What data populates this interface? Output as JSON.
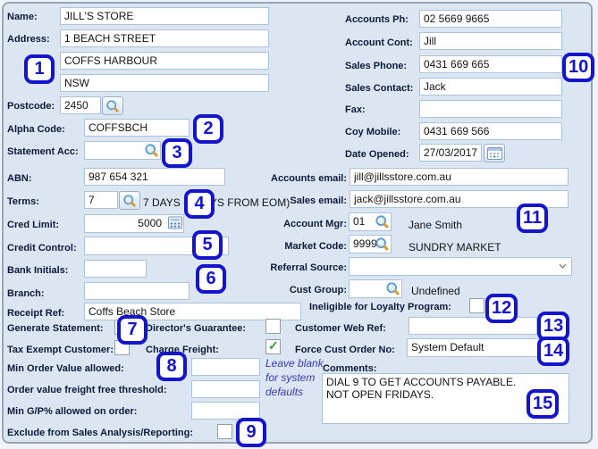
{
  "colors": {
    "accent": "#1414cd",
    "panel_bg": "#dce6f2",
    "check_green": "#2f9e33",
    "hint_blue": "#3939b8"
  },
  "badges": [
    "1",
    "2",
    "3",
    "4",
    "5",
    "6",
    "7",
    "8",
    "9",
    "10",
    "11",
    "12",
    "13",
    "14",
    "15"
  ],
  "fields": {
    "name": {
      "label": "Name:",
      "value": "JILL'S STORE"
    },
    "address": {
      "label": "Address:",
      "value": "1 BEACH STREET"
    },
    "address2": {
      "value": "COFFS HARBOUR"
    },
    "address3": {
      "value": "NSW"
    },
    "postcode": {
      "label": "Postcode:",
      "value": "2450"
    },
    "alpha_code": {
      "label": "Alpha Code:",
      "value": "COFFSBCH"
    },
    "statement_acc": {
      "label": "Statement Acc:",
      "value": ""
    },
    "abn": {
      "label": "ABN:",
      "value": "987 654 321"
    },
    "terms": {
      "label": "Terms:",
      "value": "7",
      "description": "7 DAYS (7 DAYS FROM EOM)"
    },
    "cred_limit": {
      "label": "Cred Limit:",
      "value": "5000"
    },
    "credit_control": {
      "label": "Credit Control:",
      "value": ""
    },
    "bank_initials": {
      "label": "Bank Initials:",
      "value": ""
    },
    "branch": {
      "label": "Branch:",
      "value": ""
    },
    "receipt_ref": {
      "label": "Receipt Ref:",
      "value": "Coffs Beach Store"
    },
    "accounts_ph": {
      "label": "Accounts Ph:",
      "value": "02 5669 9665"
    },
    "account_cont": {
      "label": "Account Cont:",
      "value": "Jill"
    },
    "sales_phone": {
      "label": "Sales Phone:",
      "value": "0431 669 665"
    },
    "sales_contact": {
      "label": "Sales Contact:",
      "value": "Jack"
    },
    "fax": {
      "label": "Fax:",
      "value": ""
    },
    "coy_mobile": {
      "label": "Coy Mobile:",
      "value": "0431 669 566"
    },
    "date_opened": {
      "label": "Date Opened:",
      "value": "27/03/2017"
    },
    "accounts_email": {
      "label": "Accounts email:",
      "value": "jill@jillsstore.com.au"
    },
    "sales_email": {
      "label": "Sales email:",
      "value": "jack@jillsstore.com.au"
    },
    "account_mgr": {
      "label": "Account Mgr:",
      "value": "01",
      "display": "Jane Smith"
    },
    "market_code": {
      "label": "Market Code:",
      "value": "9999",
      "display": "SUNDRY MARKET"
    },
    "referral_source": {
      "label": "Referral Source:",
      "value": ""
    },
    "cust_group": {
      "label": "Cust Group:",
      "value": "",
      "display": "Undefined"
    },
    "ineligible_loyalty": {
      "label": "Ineligible for Loyalty Program:",
      "checked": false
    },
    "generate_statement": {
      "label": "Generate Statement:",
      "checked": true
    },
    "directors_guarantee": {
      "label": "Director's Guarantee:",
      "checked": false
    },
    "customer_web_ref": {
      "label": "Customer Web Ref:",
      "value": ""
    },
    "tax_exempt": {
      "label": "Tax Exempt Customer:",
      "checked": false
    },
    "charge_freight": {
      "label": "Charge Freight:",
      "checked": true
    },
    "force_cust_order_no": {
      "label": "Force Cust Order No:",
      "value": "System Default"
    },
    "min_order_value": {
      "label": "Min Order Value allowed:",
      "value": ""
    },
    "freight_free_threshold": {
      "label": "Order value freight free threshold:",
      "value": ""
    },
    "min_gp": {
      "label": "Min G/P% allowed on order:",
      "value": ""
    },
    "exclude_sales_analysis": {
      "label": "Exclude from Sales Analysis/Reporting:",
      "checked": false
    },
    "comments": {
      "label": "Comments:",
      "value": "DIAL 9 TO GET ACCOUNTS PAYABLE.\nNOT OPEN FRIDAYS."
    }
  },
  "hint": {
    "text": "Leave blank for system defaults"
  }
}
